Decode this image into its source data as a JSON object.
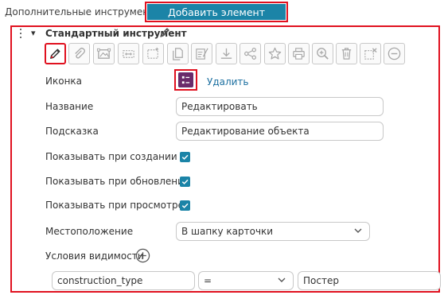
{
  "header": {
    "section_label": "Дополнительные инструменты",
    "add_button_label": "Добавить элемент"
  },
  "tool": {
    "title": "Стандартный инструмент",
    "toolbar_icons": [
      "pencil-icon",
      "paperclip-icon",
      "image-frame-icon",
      "distribute-icon",
      "marquee-select-icon",
      "copy-icon",
      "list-clear-icon",
      "download-icon",
      "share-icon",
      "star-icon",
      "print-icon",
      "zoom-in-icon",
      "trash-icon",
      "cancel-select-icon",
      "minus-circle-icon"
    ],
    "selected_icon": "pencil-icon"
  },
  "form": {
    "icon_label": "Иконка",
    "icon_delete_link": "Удалить",
    "name_label": "Название",
    "name_value": "Редактировать",
    "hint_label": "Подсказка",
    "hint_value": "Редактирование объекта",
    "show_on_create_label": "Показывать при создании",
    "show_on_create_checked": true,
    "show_on_update_label": "Показывать при обновлении",
    "show_on_update_checked": true,
    "show_on_view_label": "Показывать при просмотре",
    "show_on_view_checked": true,
    "location_label": "Местоположение",
    "location_value": "В шапку карточки",
    "visibility_label": "Условия видимости"
  },
  "condition": {
    "field": "construction_type",
    "operator": "=",
    "value": "Постер"
  },
  "colors": {
    "accent": "#1b84a7",
    "highlight": "#e0111f",
    "icon_preview_bg": "#6a2a6a"
  }
}
